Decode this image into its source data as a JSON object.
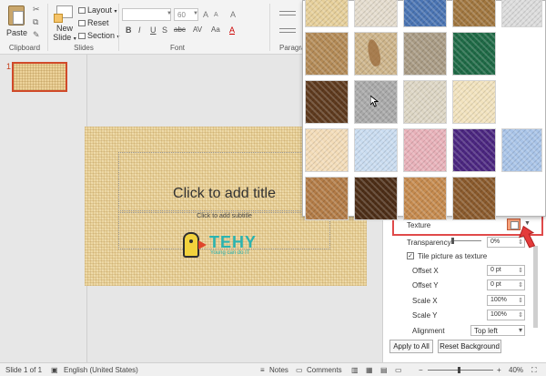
{
  "ribbon": {
    "clipboard": {
      "paste_label": "Paste",
      "group_label": "Clipboard"
    },
    "slides": {
      "new_slide_label_1": "New",
      "new_slide_label_2": "Slide",
      "layout_label": "Layout",
      "reset_label": "Reset",
      "section_label": "Section",
      "group_label": "Slides"
    },
    "font": {
      "font_name": "",
      "font_size": "60",
      "group_label": "Font",
      "bold": "B",
      "italic": "I",
      "underline": "U",
      "strike": "S",
      "shadow": "abc",
      "spacing": "AV",
      "case": "Aa",
      "grow": "A",
      "shrink": "A",
      "clear": "A"
    },
    "paragraph": {
      "group_label": "Paragra"
    }
  },
  "thumbnails": [
    {
      "number": "1"
    }
  ],
  "slide": {
    "title_placeholder": "Click to add title",
    "subtitle_placeholder": "Click to add subtitle",
    "logo_text": "TEHY",
    "logo_tagline": "Young can do IT"
  },
  "format_pane": {
    "texture_label": "Texture",
    "transparency_label": "Transparency",
    "transparency_value": "0%",
    "tile_label": "Tile picture as texture",
    "tile_checked": true,
    "offset_x_label": "Offset X",
    "offset_x_value": "0 pt",
    "offset_y_label": "Offset Y",
    "offset_y_value": "0 pt",
    "scale_x_label": "Scale X",
    "scale_x_value": "100%",
    "scale_y_label": "Scale Y",
    "scale_y_value": "100%",
    "alignment_label": "Alignment",
    "alignment_value": "Top left",
    "apply_all_label": "Apply to All",
    "reset_bg_label": "Reset Background"
  },
  "texture_gallery": {
    "rows": [
      [
        "papyrus",
        "canvas",
        "denim",
        "woven-mat"
      ],
      [
        "crumpled-paper",
        "fish-fossil",
        "sand",
        "green-marble"
      ],
      [
        "brown-marble",
        "granite",
        "recycled-paper",
        "parchment"
      ],
      [
        "stationery",
        "water-droplets",
        "pink-tissue",
        "purple-mesh"
      ],
      [
        "cork",
        "walnut",
        "oak",
        "medium-wood"
      ]
    ],
    "colors": {
      "papyrus": "#e6cf9a",
      "canvas": "#e4dccd",
      "denim": "#4a74b3",
      "woven-mat": "#a0763f",
      "crumpled-paper": "#b38a56",
      "fish-fossil": "#cdb48a",
      "sand": "#a99b84",
      "green-marble": "#1f6a46",
      "white-marble": "#dcdcdc",
      "brown-marble": "#5e3a1e",
      "granite": "#a9a9a9",
      "recycled-paper": "#ddd6c4",
      "parchment": "#f1e2bd",
      "stationery": "#f3dcb8",
      "water-droplets": "#c9dcf0",
      "pink-tissue": "#e8b1b9",
      "purple-mesh": "#4b2680",
      "blue-tissue": "#a9c4e8",
      "cork": "#b27b46",
      "walnut": "#4d2e17",
      "oak": "#c58a4e",
      "medium-wood": "#8a5a2c"
    },
    "partial_right_column": [
      "white-marble",
      "",
      "",
      "blue-tissue",
      ""
    ]
  },
  "status_bar": {
    "slide_info": "Slide 1 of 1",
    "language": "English (United States)",
    "notes_label": "Notes",
    "comments_label": "Comments",
    "zoom_value": "40%"
  }
}
